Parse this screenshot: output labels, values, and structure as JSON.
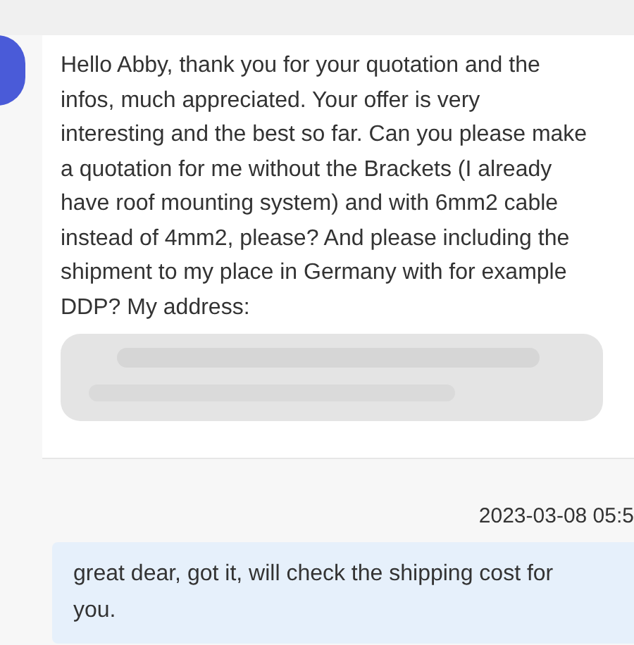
{
  "messages": [
    {
      "kind": "incoming",
      "text": "Hello Abby, thank you for your quotation and the infos, much appreciated. Your offer is very interesting and the best so far. Can you please make a quotation for me without the Brackets (I already have roof mounting system) and with 6mm2 cable instead of 4mm2, please? And please including the shipment to my place in Germany with for example DDP? My address:",
      "redacted": true
    },
    {
      "kind": "outgoing",
      "time": "2023-03-08 05:5",
      "text": "great dear, got it, will check the shipping cost for you."
    }
  ]
}
